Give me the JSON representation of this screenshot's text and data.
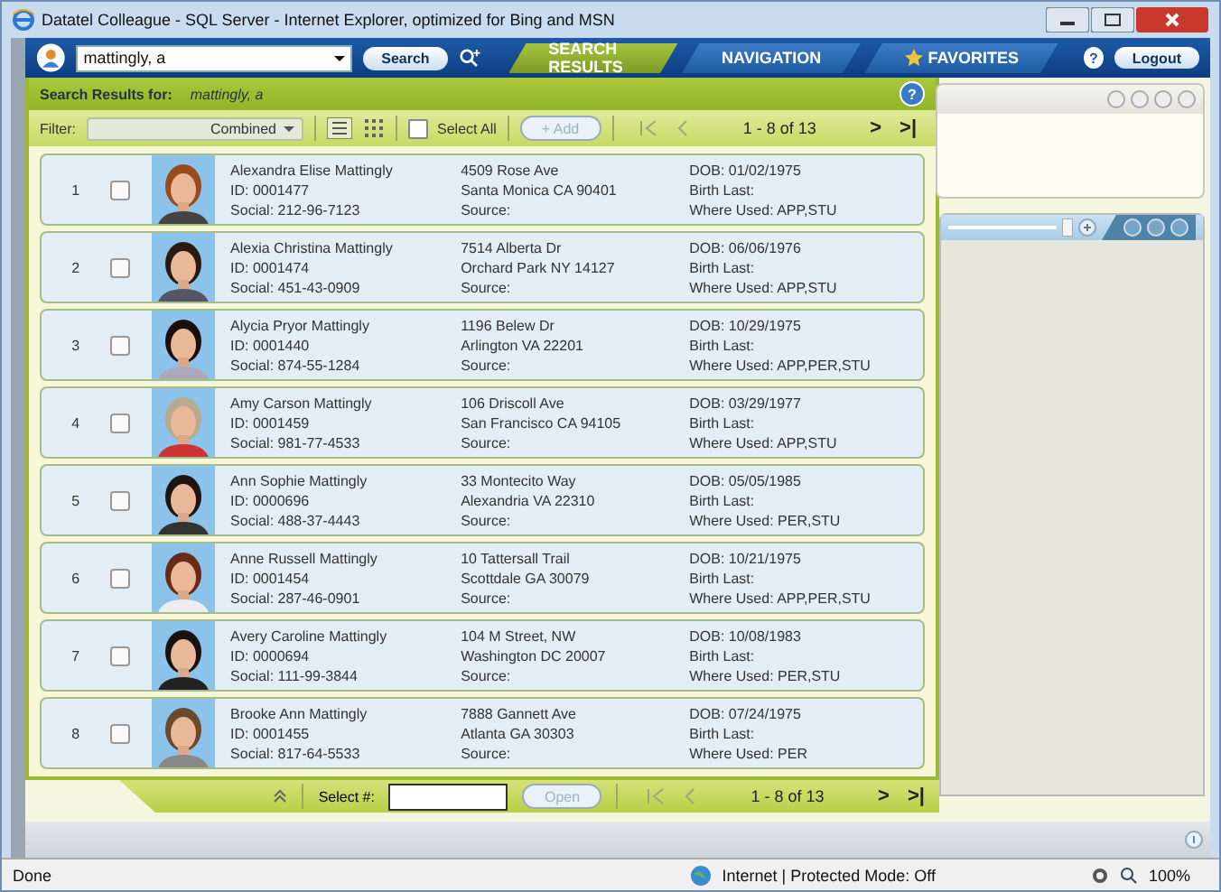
{
  "window": {
    "title": "Datatel Colleague - SQL Server - Internet Explorer, optimized for Bing and MSN"
  },
  "header": {
    "search_value": "mattingly, a",
    "search_button": "Search",
    "tabs": [
      {
        "label": "SEARCH RESULTS",
        "selected": true
      },
      {
        "label": "NAVIGATION",
        "selected": false
      },
      {
        "label": "FAVORITES",
        "selected": false
      }
    ],
    "help": "?",
    "logout": "Logout"
  },
  "results": {
    "label": "Search Results for:",
    "query": "mattingly, a",
    "help": "?",
    "filter_label": "Filter:",
    "filter_value": "Combined",
    "select_all": {
      "label": "Select All",
      "checked": false
    },
    "add_button": {
      "label": "+ Add",
      "disabled": true
    },
    "page_info": "1 - 8 of 13",
    "next": ">",
    "last": ">|",
    "rows": [
      {
        "number": "1",
        "checked": false,
        "name": "Alexandra Elise Mattingly",
        "id": "ID: 0001477",
        "social": "Social: 212-96-7123",
        "street": "4509 Rose Ave",
        "city": "Santa Monica CA 90401",
        "source": "Source:",
        "dob": "DOB: 01/02/1975",
        "birth_last": "Birth Last:",
        "where_used": "Where Used: APP,STU"
      },
      {
        "number": "2",
        "checked": false,
        "name": "Alexia Christina Mattingly",
        "id": "ID: 0001474",
        "social": "Social: 451-43-0909",
        "street": "7514 Alberta Dr",
        "city": "Orchard Park NY 14127",
        "source": "Source:",
        "dob": "DOB: 06/06/1976",
        "birth_last": "Birth Last:",
        "where_used": "Where Used: APP,STU"
      },
      {
        "number": "3",
        "checked": false,
        "name": "Alycia Pryor Mattingly",
        "id": "ID: 0001440",
        "social": "Social: 874-55-1284",
        "street": "1196 Belew Dr",
        "city": "Arlington VA 22201",
        "source": "Source:",
        "dob": "DOB: 10/29/1975",
        "birth_last": "Birth Last:",
        "where_used": "Where Used: APP,PER,STU"
      },
      {
        "number": "4",
        "checked": false,
        "name": "Amy Carson Mattingly",
        "id": "ID: 0001459",
        "social": "Social: 981-77-4533",
        "street": "106 Driscoll Ave",
        "city": "San Francisco CA 94105",
        "source": "Source:",
        "dob": "DOB: 03/29/1977",
        "birth_last": "Birth Last:",
        "where_used": "Where Used: APP,STU"
      },
      {
        "number": "5",
        "checked": false,
        "name": "Ann Sophie Mattingly",
        "id": "ID: 0000696",
        "social": "Social: 488-37-4443",
        "street": "33 Montecito Way",
        "city": "Alexandria VA 22310",
        "source": "Source:",
        "dob": "DOB: 05/05/1985",
        "birth_last": "Birth Last:",
        "where_used": "Where Used: PER,STU"
      },
      {
        "number": "6",
        "checked": false,
        "name": "Anne Russell Mattingly",
        "id": "ID: 0001454",
        "social": "Social: 287-46-0901",
        "street": "10 Tattersall Trail",
        "city": "Scottdale GA 30079",
        "source": "Source:",
        "dob": "DOB: 10/21/1975",
        "birth_last": "Birth Last:",
        "where_used": "Where Used: APP,PER,STU"
      },
      {
        "number": "7",
        "checked": false,
        "name": "Avery Caroline Mattingly",
        "id": "ID: 0000694",
        "social": "Social: 111-99-3844",
        "street": "104 M Street, NW",
        "city": "Washington DC 20007",
        "source": "Source:",
        "dob": "DOB: 10/08/1983",
        "birth_last": "Birth Last:",
        "where_used": "Where Used: PER,STU"
      },
      {
        "number": "8",
        "checked": false,
        "name": "Brooke Ann Mattingly",
        "id": "ID: 0001455",
        "social": "Social: 817-64-5533",
        "street": "7888 Gannett Ave",
        "city": "Atlanta GA 30303",
        "source": "Source:",
        "dob": "DOB: 07/24/1975",
        "birth_last": "Birth Last:",
        "where_used": "Where Used: PER"
      }
    ]
  },
  "footer": {
    "select_label": "Select #:",
    "open_button": {
      "label": "Open",
      "disabled": true
    },
    "page_info": "1 - 8 of 13",
    "next": ">",
    "last": ">|"
  },
  "status_bar": {
    "text": "Done",
    "zone": "Internet | Protected Mode: Off",
    "zoom": "100%"
  }
}
